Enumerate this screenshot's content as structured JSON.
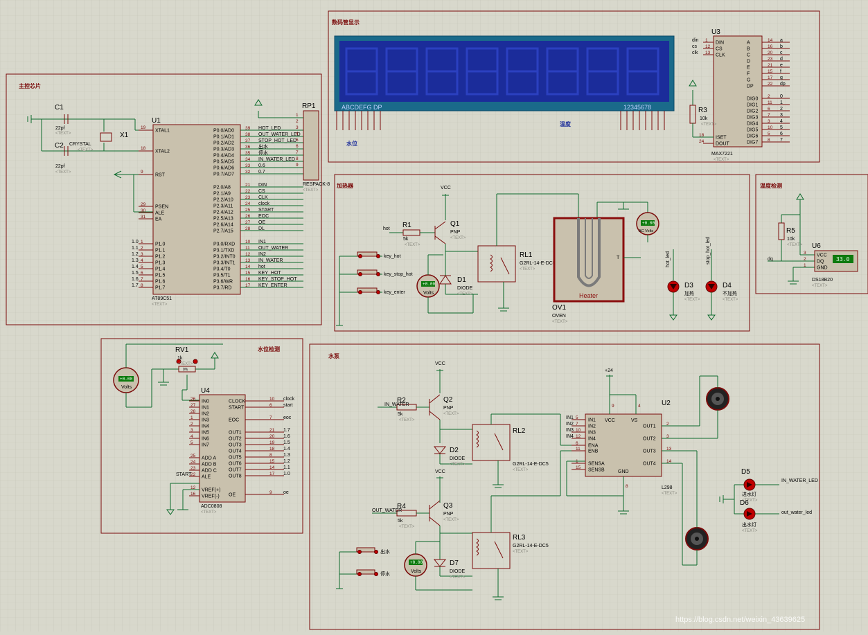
{
  "blocks": {
    "main_title": "主控芯片",
    "lcd_title": "数码管显示",
    "heater_title": "加热器",
    "temp_title": "温度检测",
    "level_title": "水位检测",
    "pump_title": "水泵"
  },
  "u1": {
    "ref": "U1",
    "part": "AT89C51",
    "text": "<TEXT>",
    "left_pins": [
      {
        "num": "19",
        "name": "XTAL1"
      },
      {
        "num": "18",
        "name": "XTAL2"
      },
      {
        "num": "9",
        "name": "RST"
      },
      {
        "num": "29",
        "name": "PSEN"
      },
      {
        "num": "30",
        "name": "ALE"
      },
      {
        "num": "31",
        "name": "EA"
      },
      {
        "num": "1",
        "name": "P1.0"
      },
      {
        "num": "2",
        "name": "P1.1"
      },
      {
        "num": "3",
        "name": "P1.2"
      },
      {
        "num": "4",
        "name": "P1.3"
      },
      {
        "num": "5",
        "name": "P1.4"
      },
      {
        "num": "6",
        "name": "P1.5"
      },
      {
        "num": "7",
        "name": "P1.6"
      },
      {
        "num": "8",
        "name": "P1.7"
      }
    ],
    "p1_labels": [
      "1.0",
      "1.1",
      "1.2",
      "1.3",
      "1.4",
      "1.5",
      "1.6",
      "1.7"
    ],
    "right_p0": [
      {
        "num": "39",
        "name": "P0.0/AD0",
        "net": "HOT_LED"
      },
      {
        "num": "38",
        "name": "P0.1/AD1",
        "net": "OUT_WATER_LED"
      },
      {
        "num": "37",
        "name": "P0.2/AD2",
        "net": "STOP_HOT_LED"
      },
      {
        "num": "36",
        "name": "P0.3/AD3",
        "net": "出水"
      },
      {
        "num": "35",
        "name": "P0.4/AD4",
        "net": "停水"
      },
      {
        "num": "34",
        "name": "P0.5/AD5",
        "net": "IN_WATER_LED"
      },
      {
        "num": "33",
        "name": "P0.6/AD6",
        "net": "0.6"
      },
      {
        "num": "32",
        "name": "P0.7/AD7",
        "net": "0.7"
      }
    ],
    "right_p2": [
      {
        "num": "21",
        "name": "P2.0/A8",
        "net": "DIN"
      },
      {
        "num": "22",
        "name": "P2.1/A9",
        "net": "CS"
      },
      {
        "num": "23",
        "name": "P2.2/A10",
        "net": "CLK"
      },
      {
        "num": "24",
        "name": "P2.3/A11",
        "net": "clock"
      },
      {
        "num": "25",
        "name": "P2.4/A12",
        "net": "START"
      },
      {
        "num": "26",
        "name": "P2.5/A13",
        "net": "EOC"
      },
      {
        "num": "27",
        "name": "P2.6/A14",
        "net": "OE"
      },
      {
        "num": "28",
        "name": "P2.7/A15",
        "net": "DL"
      }
    ],
    "right_p3": [
      {
        "num": "10",
        "name": "P3.0/RXD",
        "net": "IN1"
      },
      {
        "num": "11",
        "name": "P3.1/TXD",
        "net": "OUT_WATER"
      },
      {
        "num": "12",
        "name": "P3.2/INT0",
        "net": "IN2"
      },
      {
        "num": "13",
        "name": "P3.3/INT1",
        "net": "IN_WATER"
      },
      {
        "num": "14",
        "name": "P3.4/T0",
        "net": "hot"
      },
      {
        "num": "15",
        "name": "P3.5/T1",
        "net": "KEY_HOT"
      },
      {
        "num": "16",
        "name": "P3.6/WR",
        "net": "KEY_STOP_HOT"
      },
      {
        "num": "17",
        "name": "P3.7/RD",
        "net": "KEY_ENTER"
      }
    ]
  },
  "c1": {
    "ref": "C1",
    "val": "22pf",
    "text": "<TEXT>"
  },
  "c2": {
    "ref": "C2",
    "val": "22pf",
    "text": "<TEXT>"
  },
  "x1": {
    "ref": "X1",
    "val": "CRYSTAL",
    "text": "<TEXT>"
  },
  "rp1": {
    "ref": "RP1",
    "val": "RESPACK-8",
    "text": "<TEXT>",
    "pins": [
      "1",
      "2",
      "3",
      "4",
      "5",
      "6",
      "7",
      "8",
      "9"
    ]
  },
  "lcd": {
    "left_label": "ABCDEFG  DP",
    "right_label": "12345678",
    "tag_left": "水位",
    "tag_mid": "温度"
  },
  "u3": {
    "ref": "U3",
    "part": "MAX7221",
    "text": "<TEXT>",
    "left_pins": [
      {
        "num": "1",
        "name": "DIN",
        "net": "din"
      },
      {
        "num": "12",
        "name": "CS",
        "net": "cs"
      },
      {
        "num": "13",
        "name": "CLK",
        "net": "clk"
      }
    ],
    "left_low": [
      {
        "num": "18",
        "name": "ISET"
      },
      {
        "num": "24",
        "name": "DOUT"
      }
    ],
    "right_pins": [
      {
        "num": "14",
        "name": "A",
        "net": "a"
      },
      {
        "num": "16",
        "name": "B",
        "net": "b"
      },
      {
        "num": "20",
        "name": "C",
        "net": "c"
      },
      {
        "num": "23",
        "name": "D",
        "net": "d"
      },
      {
        "num": "21",
        "name": "E",
        "net": "e"
      },
      {
        "num": "15",
        "name": "F",
        "net": "f"
      },
      {
        "num": "17",
        "name": "G",
        "net": "g"
      },
      {
        "num": "22",
        "name": "DP",
        "net": "dp"
      },
      {
        "num": "2",
        "name": "DIG0",
        "net": "0"
      },
      {
        "num": "11",
        "name": "DIG1",
        "net": "1"
      },
      {
        "num": "6",
        "name": "DIG2",
        "net": "2"
      },
      {
        "num": "7",
        "name": "DIG3",
        "net": "3"
      },
      {
        "num": "3",
        "name": "DIG4",
        "net": "4"
      },
      {
        "num": "10",
        "name": "DIG5",
        "net": "5"
      },
      {
        "num": "5",
        "name": "DIG6",
        "net": "6"
      },
      {
        "num": "8",
        "name": "DIG7",
        "net": "7"
      }
    ]
  },
  "r3": {
    "ref": "R3",
    "val": "10k",
    "text": "<TEXT>"
  },
  "heater": {
    "q1": {
      "ref": "Q1",
      "val": "PNP",
      "text": "<TEXT>"
    },
    "r1": {
      "ref": "R1",
      "val": "5k",
      "text": "<TEXT>"
    },
    "net_hot": "hot",
    "vcc": "VCC",
    "keys": [
      "key_hot",
      "key_stop_hot",
      "key_enter"
    ],
    "rl1": {
      "ref": "RL1",
      "val": "G2RL-14-E-DC5",
      "text": "<TEXT>"
    },
    "d1": {
      "ref": "D1",
      "val": "DIODE",
      "text": "<TEXT>"
    },
    "ov1": {
      "ref": "OV1",
      "val": "OVEN",
      "text": "<TEXT>",
      "inner": "Heater",
      "t": "T"
    },
    "meter1": {
      "label": "Volts",
      "val": "+0.00"
    },
    "ac_meter": {
      "label": "AC Volts",
      "val": "+0.00"
    },
    "d3": {
      "ref": "D3",
      "val": "加热",
      "text": "<TEXT>",
      "net": "hot_led"
    },
    "d4": {
      "ref": "D4",
      "val": "不加热",
      "text": "<TEXT>",
      "net": "stop_hot_led"
    }
  },
  "temp": {
    "r5": {
      "ref": "R5",
      "val": "10k",
      "text": "<TEXT>"
    },
    "u6": {
      "ref": "U6",
      "part": "DS18B20",
      "text": "<TEXT>",
      "display": "33.0",
      "pins": [
        {
          "num": "3",
          "name": "VCC"
        },
        {
          "num": "2",
          "name": "DQ"
        },
        {
          "num": "1",
          "name": "GND"
        }
      ]
    },
    "net": "dq"
  },
  "level": {
    "rv1": {
      "ref": "RV1",
      "val": "1k",
      "text": "<TEXT>",
      "pct": "0%"
    },
    "meter": {
      "label": "Volts",
      "val": "+0.00"
    },
    "u4": {
      "ref": "U4",
      "part": "ADC0808",
      "text": "<TEXT>",
      "left": [
        {
          "num": "26",
          "name": "IN0"
        },
        {
          "num": "27",
          "name": "IN1"
        },
        {
          "num": "28",
          "name": "IN2"
        },
        {
          "num": "1",
          "name": "IN3"
        },
        {
          "num": "2",
          "name": "IN4"
        },
        {
          "num": "3",
          "name": "IN5"
        },
        {
          "num": "4",
          "name": "IN6"
        },
        {
          "num": "5",
          "name": "IN7"
        },
        {
          "num": "25",
          "name": "ADD A"
        },
        {
          "num": "24",
          "name": "ADD B"
        },
        {
          "num": "23",
          "name": "ADD C"
        },
        {
          "num": "22",
          "name": "ALE"
        },
        {
          "num": "12",
          "name": "VREF(+)"
        },
        {
          "num": "16",
          "name": "VREF(-)"
        }
      ],
      "right": [
        {
          "num": "10",
          "name": "CLOCK",
          "net": "clock"
        },
        {
          "num": "6",
          "name": "START",
          "net": "start"
        },
        {
          "num": "7",
          "name": "EOC",
          "net": "eoc"
        },
        {
          "num": "21",
          "name": "OUT1",
          "net": "1.7"
        },
        {
          "num": "20",
          "name": "OUT2",
          "net": "1.6"
        },
        {
          "num": "19",
          "name": "OUT3",
          "net": "1.5"
        },
        {
          "num": "18",
          "name": "OUT4",
          "net": "1.4"
        },
        {
          "num": "8",
          "name": "OUT5",
          "net": "1.3"
        },
        {
          "num": "15",
          "name": "OUT6",
          "net": "1.2"
        },
        {
          "num": "14",
          "name": "OUT7",
          "net": "1.1"
        },
        {
          "num": "17",
          "name": "OUT8",
          "net": "1.0"
        },
        {
          "num": "9",
          "name": "OE",
          "net": "oe"
        }
      ],
      "start_net": "START"
    }
  },
  "pump": {
    "q2": {
      "ref": "Q2",
      "val": "PNP",
      "text": "<TEXT>"
    },
    "r2": {
      "ref": "R2",
      "val": "5k",
      "text": "<TEXT>",
      "net": "IN_WATER"
    },
    "q3": {
      "ref": "Q3",
      "val": "PNP",
      "text": "<TEXT>"
    },
    "r4": {
      "ref": "R4",
      "val": "5k",
      "text": "<TEXT>",
      "net": "OUT_WATER"
    },
    "d2": {
      "ref": "D2",
      "val": "DIODE",
      "text": "<TEXT>"
    },
    "d7": {
      "ref": "D7",
      "val": "DIODE",
      "text": "<TEXT>"
    },
    "rl2": {
      "ref": "RL2",
      "val": "G2RL-14-E-DC5",
      "text": "<TEXT>"
    },
    "rl3": {
      "ref": "RL3",
      "val": "G2RL-14-E-DC5",
      "text": "<TEXT>"
    },
    "vcc": "VCC",
    "keys": [
      "出水",
      "停水"
    ],
    "meter": {
      "label": "Volts",
      "val": "+0.00"
    },
    "u2": {
      "ref": "U2",
      "part": "L298",
      "text": "<TEXT>",
      "pwr": "+24",
      "left": [
        {
          "num": "5",
          "name": "IN1",
          "net": "IN1"
        },
        {
          "num": "7",
          "name": "IN2",
          "net": "IN2"
        },
        {
          "num": "10",
          "name": "IN3",
          "net": "IN3"
        },
        {
          "num": "12",
          "name": "IN4",
          "net": "IN4"
        },
        {
          "num": "6",
          "name": "ENA"
        },
        {
          "num": "11",
          "name": "ENB"
        },
        {
          "num": "1",
          "name": "SENSA"
        },
        {
          "num": "15",
          "name": "SENSB"
        }
      ],
      "right": [
        {
          "num": "2",
          "name": "OUT1"
        },
        {
          "num": "3",
          "name": "OUT2"
        },
        {
          "num": "13",
          "name": "OUT3"
        },
        {
          "num": "14",
          "name": "OUT4"
        }
      ],
      "top": [
        {
          "num": "9",
          "name": "VCC"
        },
        {
          "num": "4",
          "name": "VS"
        }
      ],
      "gnd": {
        "num": "8",
        "name": "GND"
      }
    },
    "d5": {
      "ref": "D5",
      "val": "进水灯",
      "text": "<TEXT>",
      "net": "IN_WATER_LED"
    },
    "d6": {
      "ref": "D6",
      "val": "出水灯",
      "text": "<TEXT>",
      "net": "out_water_led"
    }
  },
  "watermark": "https://blog.csdn.net/weixin_43639625"
}
